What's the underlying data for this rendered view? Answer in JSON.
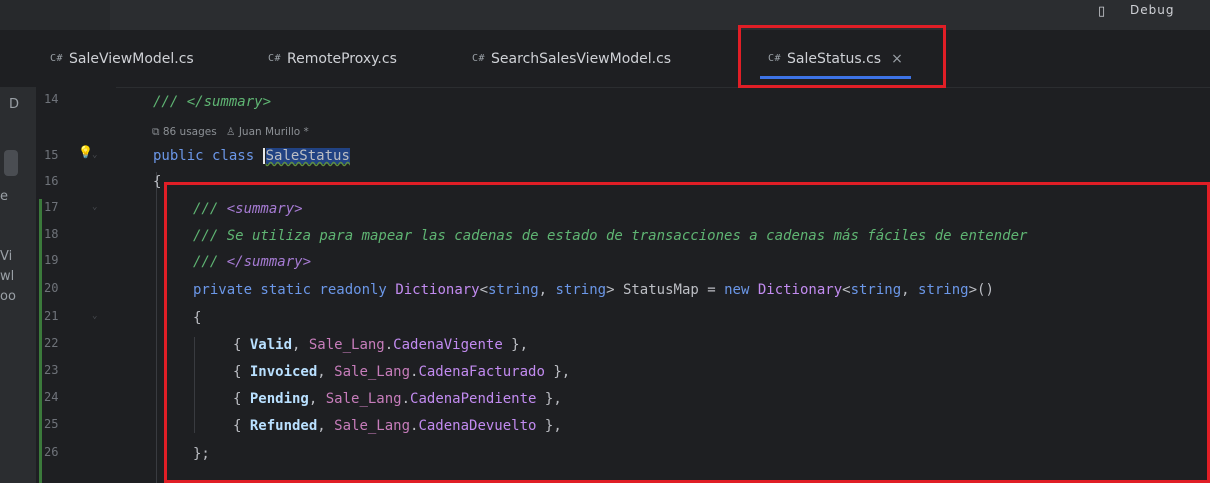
{
  "tabs": [
    {
      "lang": "C#",
      "label": "SaleViewModel.cs",
      "active": false
    },
    {
      "lang": "C#",
      "label": "RemoteProxy.cs",
      "active": false
    },
    {
      "lang": "C#",
      "label": "SearchSalesViewModel.cs",
      "active": false
    },
    {
      "lang": "C#",
      "label": "SaleStatus.cs",
      "active": true,
      "close": "×"
    }
  ],
  "topbar": {
    "right_fragment": "Debug"
  },
  "sidebar": {
    "fragments": [
      "D",
      "e",
      "Vi",
      "wl",
      "oo"
    ]
  },
  "line_numbers": [
    "14",
    "15",
    "16",
    "17",
    "18",
    "19",
    "20",
    "21",
    "22",
    "23",
    "24",
    "25",
    "26"
  ],
  "inlay": {
    "usages": "86 usages",
    "author": "Juan Murillo *"
  },
  "code": {
    "l14_comment": "/// </summary>",
    "l15_kw": "public class",
    "l15_class": "SaleStatus",
    "l16": "{",
    "l17_prefix": "/// ",
    "l17_tag": "<summary>",
    "l18": "/// Se utiliza para mapear las cadenas de estado de transacciones a cadenas más fáciles de entender",
    "l19_prefix": "/// ",
    "l19_tag": "</summary>",
    "l20_kw": "private static readonly",
    "l20_type": "Dictionary",
    "l20_generic1": "<",
    "l20_string": "string",
    "l20_comma": ", ",
    "l20_string2": "string",
    "l20_close": ">",
    "l20_name": "StatusMap",
    "l20_eq": "=",
    "l20_new": "new",
    "l20_type2": "Dictionary",
    "l20_lt2": "<",
    "l20_string3": "string",
    "l20_comma2": ", ",
    "l20_string4": "string",
    "l20_gt2": ">()",
    "l21": "{",
    "entries": [
      {
        "key": "Valid",
        "cls": "Sale_Lang",
        "prop": "CadenaVigente"
      },
      {
        "key": "Invoiced",
        "cls": "Sale_Lang",
        "prop": "CadenaFacturado"
      },
      {
        "key": "Pending",
        "cls": "Sale_Lang",
        "prop": "CadenaPendiente"
      },
      {
        "key": "Refunded",
        "cls": "Sale_Lang",
        "prop": "CadenaDevuelto"
      }
    ],
    "l26": "};"
  },
  "colors": {
    "highlight_border": "#e01e26",
    "tab_underline": "#3d73e6"
  }
}
